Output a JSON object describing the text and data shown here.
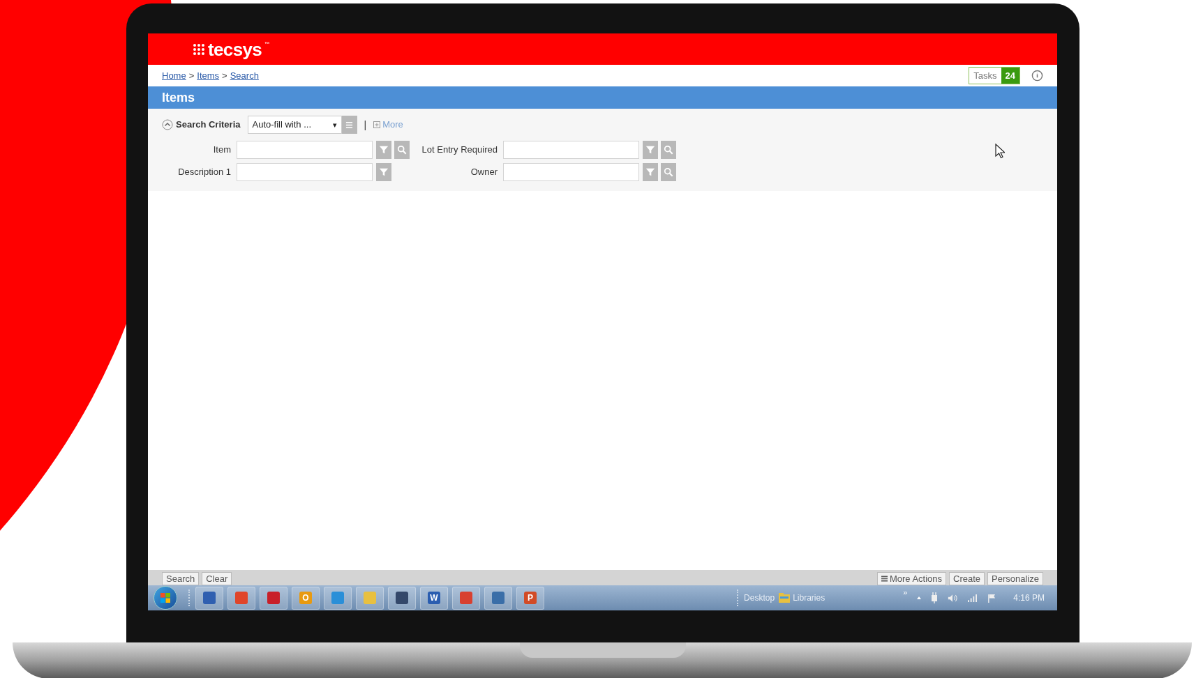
{
  "header": {
    "logo": "tecsys",
    "trademark": "™"
  },
  "breadcrumb": [
    {
      "kind": "link",
      "label": "Home"
    },
    {
      "kind": "sep",
      "label": ">"
    },
    {
      "kind": "link",
      "label": "Items"
    },
    {
      "kind": "sep",
      "label": ">"
    },
    {
      "kind": "link",
      "label": "Search"
    }
  ],
  "tasks": {
    "label": "Tasks",
    "count": "24"
  },
  "page_title": "Items",
  "search_criteria": {
    "label": "Search Criteria",
    "expanded": true,
    "autofill": "Auto-fill with ...",
    "caret": "▾",
    "divider": "|",
    "more": "More"
  },
  "fields": [
    {
      "label": "Item",
      "filter": true,
      "lookup": true
    },
    {
      "label": "Lot Entry Required",
      "filter": true,
      "lookup": true
    },
    {
      "label": "Description 1",
      "filter": true,
      "lookup": false
    },
    {
      "label": "Owner",
      "filter": true,
      "lookup": true
    }
  ],
  "footer": {
    "left_buttons": [
      {
        "label": "Search"
      },
      {
        "label": "Clear"
      }
    ],
    "right_buttons": [
      {
        "label": "More Actions",
        "menu": true
      },
      {
        "label": "Create",
        "menu": false
      },
      {
        "label": "Personalize",
        "menu": false
      }
    ]
  },
  "taskbar": {
    "apps": [
      {
        "color": "#2f5fb0"
      },
      {
        "color": "#e0452a"
      },
      {
        "color": "#c8202a"
      },
      {
        "color": "#e89a10",
        "glyph": "O"
      },
      {
        "color": "#2a8fd8"
      },
      {
        "color": "#e8c040"
      },
      {
        "color": "#34486a"
      },
      {
        "color": "#2a5db0",
        "glyph": "W"
      },
      {
        "color": "#d84030"
      },
      {
        "color": "#3a6ea8"
      },
      {
        "color": "#d24b26",
        "glyph": "P"
      }
    ],
    "desktop": "Desktop",
    "libraries": "Libraries",
    "chevron": "»",
    "time": "4:16 PM"
  }
}
